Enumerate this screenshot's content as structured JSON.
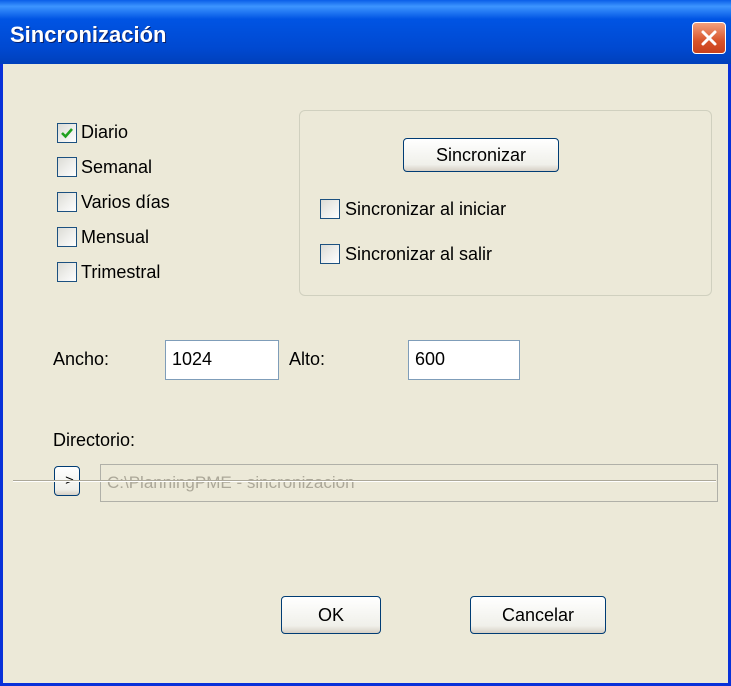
{
  "window": {
    "title": "Sincronización"
  },
  "options": {
    "daily": {
      "label": "Diario",
      "checked": true
    },
    "weekly": {
      "label": "Semanal",
      "checked": false
    },
    "several_days": {
      "label": "Varios días",
      "checked": false
    },
    "monthly": {
      "label": "Mensual",
      "checked": false
    },
    "quarterly": {
      "label": "Trimestral",
      "checked": false
    }
  },
  "sync_group": {
    "sync_button": "Sincronizar",
    "sync_on_start": {
      "label": "Sincronizar al iniciar",
      "checked": false
    },
    "sync_on_exit": {
      "label": "Sincronizar al salir",
      "checked": false
    }
  },
  "size": {
    "width_label": "Ancho:",
    "width_value": "1024",
    "height_label": "Alto:",
    "height_value": "600"
  },
  "directory": {
    "label": "Directorio:",
    "browse_button": "->",
    "path": "C:\\PlanningPME - sincronizacion"
  },
  "buttons": {
    "ok": "OK",
    "cancel": "Cancelar"
  },
  "icons": {
    "check": "checkmark-icon",
    "close": "close-icon"
  },
  "colors": {
    "title_bar": "#0054E3",
    "close_button": "#D8542A",
    "checkmark": "#21A121",
    "window_bg": "#ECE9D8"
  }
}
